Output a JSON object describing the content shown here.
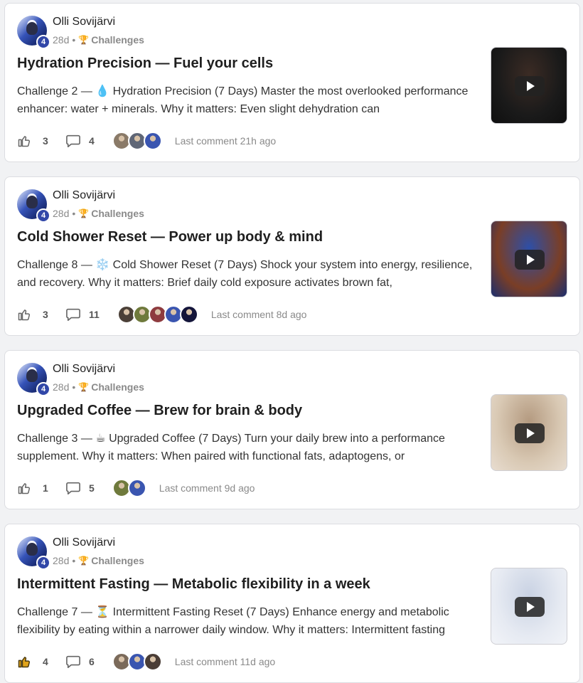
{
  "posts": [
    {
      "author": "Olli Sovijärvi",
      "level": "4",
      "time": "28d",
      "category": "Challenges",
      "title": "Hydration Precision — Fuel your cells",
      "excerpt": "Challenge 2 — 💧 Hydration Precision (7 Days) Master the most overlooked performance enhancer: water + minerals. Why it matters: Even slight dehydration can",
      "likes": "3",
      "comments": "4",
      "last_comment": "Last comment 21h ago",
      "liked": false,
      "thumbnail_colors": [
        "#1a1a1a",
        "#3b2b24",
        "#0f0f0f"
      ],
      "commenter_colors": [
        "#8a7a68",
        "#5f6676",
        "#3a55b0"
      ]
    },
    {
      "author": "Olli Sovijärvi",
      "level": "4",
      "time": "28d",
      "category": "Challenges",
      "title": "Cold Shower Reset — Power up body & mind",
      "excerpt": "Challenge 8 — ❄️ Cold Shower Reset (7 Days) Shock your system into energy, resilience, and recovery. Why it matters: Brief daily cold exposure activates brown fat,",
      "likes": "3",
      "comments": "11",
      "last_comment": "Last comment 8d ago",
      "liked": false,
      "thumbnail_colors": [
        "#7a3e26",
        "#2d4fa8",
        "#1b2e6e"
      ],
      "commenter_colors": [
        "#4b4038",
        "#6f7a3c",
        "#8e3b3f",
        "#3a55b0",
        "#14153a"
      ]
    },
    {
      "author": "Olli Sovijärvi",
      "level": "4",
      "time": "28d",
      "category": "Challenges",
      "title": "Upgraded Coffee — Brew for brain & body",
      "excerpt": "Challenge 3 — ☕ Upgraded Coffee (7 Days) Turn your daily brew into a performance supplement. Why it matters: When paired with functional fats, adaptogens, or",
      "likes": "1",
      "comments": "5",
      "last_comment": "Last comment 9d ago",
      "liked": false,
      "thumbnail_colors": [
        "#d9c9b4",
        "#b49a80",
        "#e8ddd0"
      ],
      "commenter_colors": [
        "#6f7a3c",
        "#3a55b0"
      ]
    },
    {
      "author": "Olli Sovijärvi",
      "level": "4",
      "time": "28d",
      "category": "Challenges",
      "title": "Intermittent Fasting — Metabolic flexibility in a week",
      "excerpt": "Challenge 7 — ⏳ Intermittent Fasting Reset (7 Days) Enhance energy and metabolic flexibility by eating within a narrower daily window. Why it matters: Intermittent fasting",
      "likes": "4",
      "comments": "6",
      "last_comment": "Last comment 11d ago",
      "liked": true,
      "thumbnail_colors": [
        "#e6eaf2",
        "#c9d2e3",
        "#f2f4f8"
      ],
      "commenter_colors": [
        "#7b6a5a",
        "#3a55b0",
        "#4a3d36"
      ]
    }
  ],
  "colors": {
    "like_active": "#e0a41c",
    "icon_default": "#666666",
    "badge": "#3147a8"
  }
}
